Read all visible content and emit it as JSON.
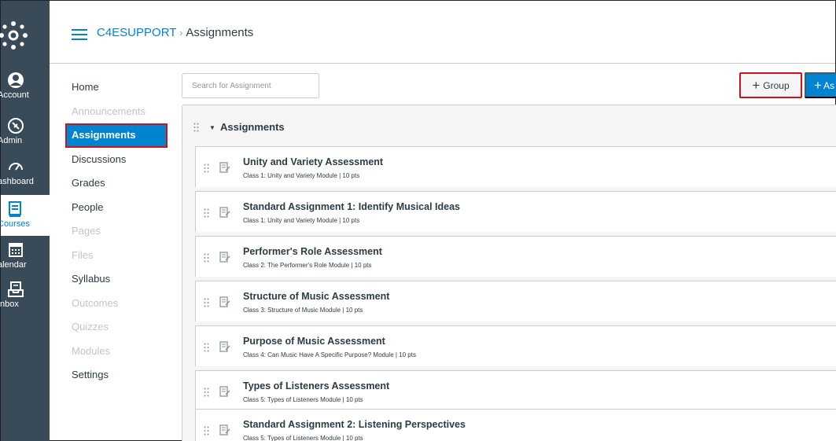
{
  "global_nav": {
    "items": [
      {
        "label": "Account",
        "icon": "account-icon"
      },
      {
        "label": "Admin",
        "icon": "admin-shield-icon"
      },
      {
        "label": "ashboard",
        "icon": "dashboard-icon"
      },
      {
        "label": "Courses",
        "icon": "courses-icon",
        "active": true
      },
      {
        "label": "alendar",
        "icon": "calendar-icon"
      },
      {
        "label": "Inbox",
        "icon": "inbox-icon"
      }
    ]
  },
  "header": {
    "course": "C4ESUPPORT",
    "separator": "›",
    "current": "Assignments"
  },
  "course_nav": {
    "items": [
      {
        "label": "Home",
        "state": "normal"
      },
      {
        "label": "Announcements",
        "state": "dim"
      },
      {
        "label": "Assignments",
        "state": "active"
      },
      {
        "label": "Discussions",
        "state": "normal"
      },
      {
        "label": "Grades",
        "state": "normal"
      },
      {
        "label": "People",
        "state": "normal"
      },
      {
        "label": "Pages",
        "state": "dim"
      },
      {
        "label": "Files",
        "state": "dim"
      },
      {
        "label": "Syllabus",
        "state": "normal"
      },
      {
        "label": "Outcomes",
        "state": "dim"
      },
      {
        "label": "Quizzes",
        "state": "dim"
      },
      {
        "label": "Modules",
        "state": "dim"
      },
      {
        "label": "Settings",
        "state": "normal"
      }
    ]
  },
  "toolbar": {
    "search_placeholder": "Search for Assignment",
    "group_label": "Group",
    "assignment_label": "As"
  },
  "group": {
    "title": "Assignments",
    "assignments": [
      {
        "title": "Unity and Variety Assessment",
        "meta": "Class 1: Unity and Variety Module  |  10 pts"
      },
      {
        "title": "Standard Assignment 1: Identify Musical Ideas",
        "meta": "Class 1: Unity and Variety Module  |  10 pts"
      },
      {
        "title": "Performer's Role Assessment",
        "meta": "Class 2: The Performer's Role Module  |  10 pts"
      },
      {
        "title": "Structure of Music Assessment",
        "meta": "Class 3: Structure of Music Module  |  10 pts"
      },
      {
        "title": "Purpose of Music Assessment",
        "meta": "Class 4: Can Music Have A Specific Purpose? Module  |  10 pts"
      },
      {
        "title": "Types of Listeners Assessment",
        "meta": "Class 5: Types of Listeners Module  |  10 pts"
      },
      {
        "title": "Standard Assignment 2: Listening Perspectives",
        "meta": "Class 5: Types of Listeners Module  |  10 pts"
      }
    ]
  },
  "colors": {
    "nav_bg": "#394b58",
    "brand_blue": "#0084d1",
    "highlight_red": "#d01219"
  }
}
